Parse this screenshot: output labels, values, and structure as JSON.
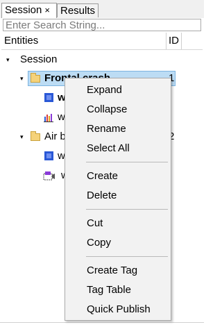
{
  "tabs": {
    "session": "Session",
    "session_close": "×",
    "results": "Results"
  },
  "search": {
    "placeholder": "Enter Search String..."
  },
  "columns": {
    "entities": "Entities",
    "id": "ID"
  },
  "tree": {
    "session": {
      "label": "Session"
    },
    "frontal": {
      "label": "Frontal crash",
      "id": "1"
    },
    "frontal_child_1": {
      "label": "w",
      "icon": "blue-element-icon"
    },
    "frontal_child_2": {
      "label": "w",
      "icon": "bar-chart-icon"
    },
    "airbag": {
      "label": "Air b",
      "id": "2"
    },
    "airbag_child_1": {
      "label": "w",
      "icon": "blue-element-icon"
    },
    "airbag_child_2": {
      "label": "w",
      "icon": "camera-icon"
    }
  },
  "context_menu": {
    "expand": "Expand",
    "collapse": "Collapse",
    "rename": "Rename",
    "select_all": "Select All",
    "create": "Create",
    "delete": "Delete",
    "cut": "Cut",
    "copy": "Copy",
    "create_tag": "Create Tag",
    "tag_table": "Tag Table",
    "quick_publish": "Quick Publish"
  },
  "colors": {
    "selection": "#bcdcf4",
    "folder": "#f5d27a",
    "menu_bg": "#f2f2f2"
  }
}
